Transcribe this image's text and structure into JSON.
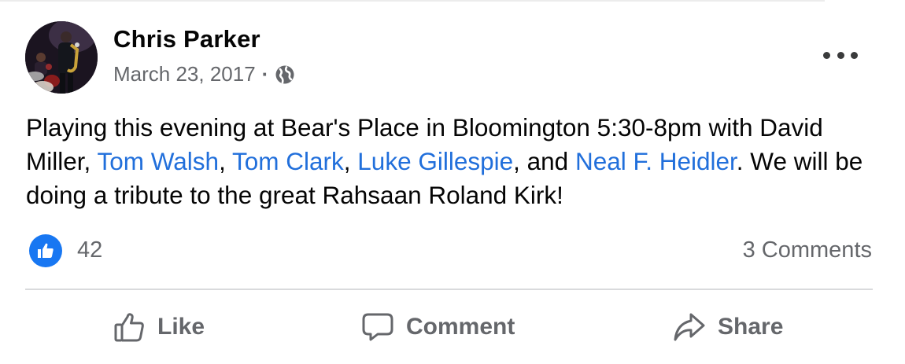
{
  "post": {
    "author": "Chris Parker",
    "date": "March 23, 2017",
    "separator": "·",
    "privacy_icon": "globe-icon",
    "more_icon": "more-options-icon",
    "body": [
      {
        "text": "Playing this evening at Bear's Place in Bloomington 5:30-8pm with David Miller, ",
        "link": false
      },
      {
        "text": "Tom Walsh",
        "link": true
      },
      {
        "text": ", ",
        "link": false
      },
      {
        "text": "Tom Clark",
        "link": true
      },
      {
        "text": ", ",
        "link": false
      },
      {
        "text": "Luke Gillespie",
        "link": true
      },
      {
        "text": ", and ",
        "link": false
      },
      {
        "text": "Neal F. Heidler",
        "link": true
      },
      {
        "text": ". We will be doing a tribute to the great Rahsaan Roland Kirk!",
        "link": false
      }
    ]
  },
  "reactions": {
    "like_count": "42",
    "comments_label": "3 Comments"
  },
  "actions": {
    "like_label": "Like",
    "comment_label": "Comment",
    "share_label": "Share"
  },
  "colors": {
    "link": "#216fdb",
    "like_blue": "#1877f2",
    "secondary_text": "#65676b"
  }
}
